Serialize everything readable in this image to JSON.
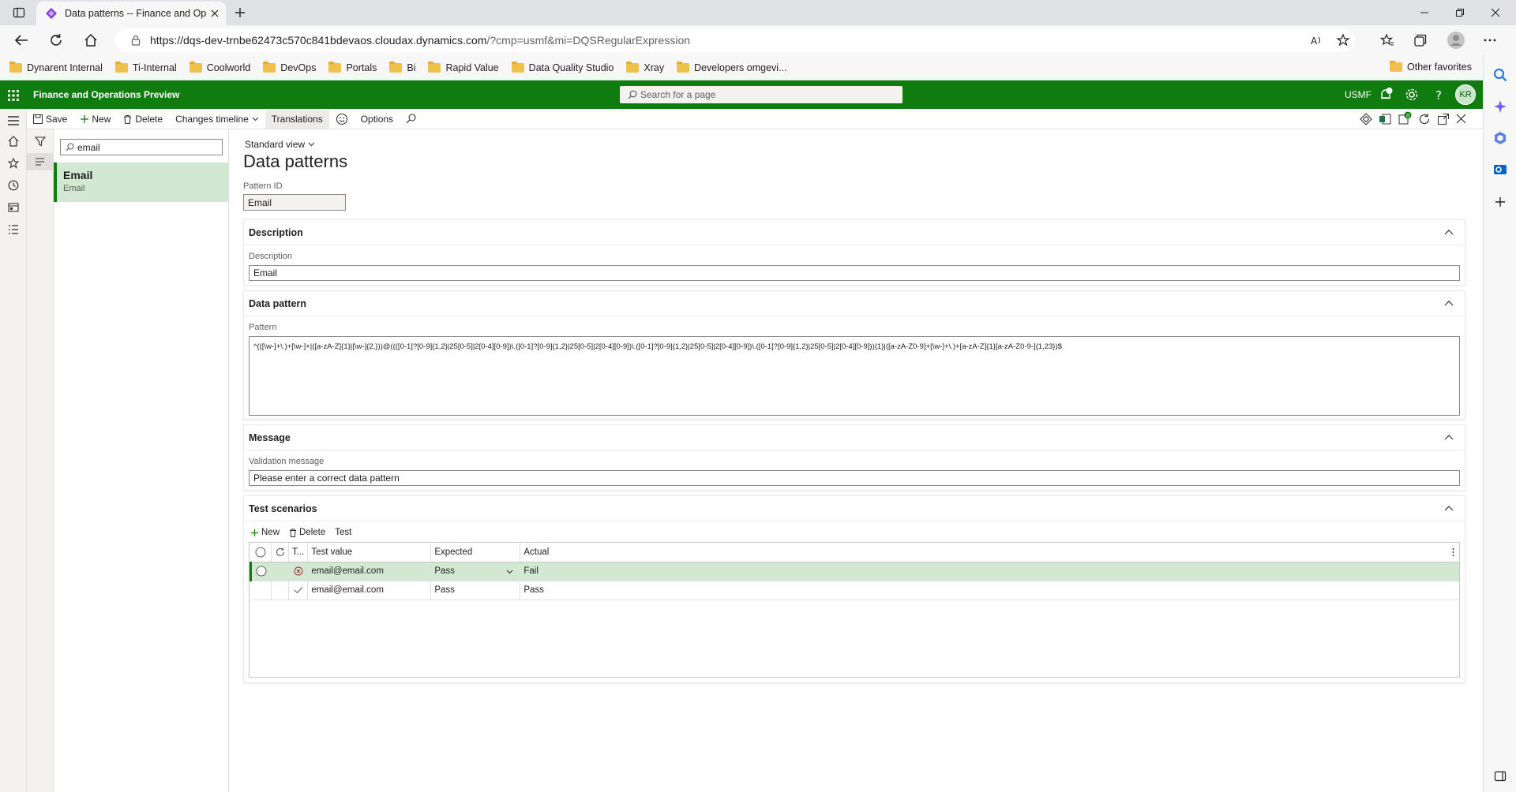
{
  "browser": {
    "tab_title": "Data patterns -- Finance and Operations",
    "url_host": "https://dqs-dev-trnbe62473c570c841bdevaos.cloudax.dynamics.com",
    "url_query": "/?cmp=usmf&mi=DQSRegularExpression",
    "favorites": [
      "Dynarent Internal",
      "Ti-Internal",
      "Coolworld",
      "DevOps",
      "Portals",
      "Bi",
      "Rapid Value",
      "Data Quality Studio",
      "Xray",
      "Developers omgevi..."
    ],
    "other_favorites": "Other favorites"
  },
  "app": {
    "name": "Finance and Operations Preview",
    "search_placeholder": "Search for a page",
    "company": "USMF",
    "user_initials": "KR",
    "notification_count": "0"
  },
  "actions": {
    "save": "Save",
    "new": "New",
    "delete": "Delete",
    "changes_timeline": "Changes timeline",
    "translations": "Translations",
    "options": "Options"
  },
  "list": {
    "filter_value": "email",
    "items": [
      {
        "title": "Email",
        "subtitle": "Email"
      }
    ]
  },
  "main": {
    "view": "Standard view",
    "page_title": "Data patterns",
    "pattern_id_label": "Pattern ID",
    "pattern_id_value": "Email",
    "description_section": "Description",
    "description_label": "Description",
    "description_value": "Email",
    "data_pattern_section": "Data pattern",
    "pattern_label": "Pattern",
    "pattern_value": "^(([\\w-]+\\.)+[\\w-]+|([a-zA-Z]{1}|[\\w-]{2,}))@((([0-1]?[0-9]{1,2}|25[0-5]|2[0-4][0-9])\\.([0-1]?[0-9]{1,2}|25[0-5]|2[0-4][0-9])\\.([0-1]?[0-9]{1,2}|25[0-5]|2[0-4][0-9])\\.([0-1]?[0-9]{1,2}|25[0-5]|2[0-4][0-9])){1}|([a-zA-Z0-9]+[\\w-]+\\.)+[a-zA-Z]{1}[a-zA-Z0-9-]{1,23})$",
    "message_section": "Message",
    "validation_label": "Validation message",
    "validation_value": "Please enter a correct data pattern",
    "test_section": "Test scenarios",
    "test_new": "New",
    "test_delete": "Delete",
    "test_test": "Test",
    "grid_headers": {
      "t": "T...",
      "value": "Test value",
      "expected": "Expected",
      "actual": "Actual"
    },
    "rows": [
      {
        "value": "email@email.com",
        "expected": "Pass",
        "actual": "Fail",
        "status_icon": "error-circle-icon"
      },
      {
        "value": "email@email.com",
        "expected": "Pass",
        "actual": "Pass",
        "status_icon": "checkmark-icon"
      }
    ]
  },
  "colors": {
    "brand_green": "#107c10",
    "selected_row": "#d2e8d2",
    "error_red": "#a4262c"
  }
}
